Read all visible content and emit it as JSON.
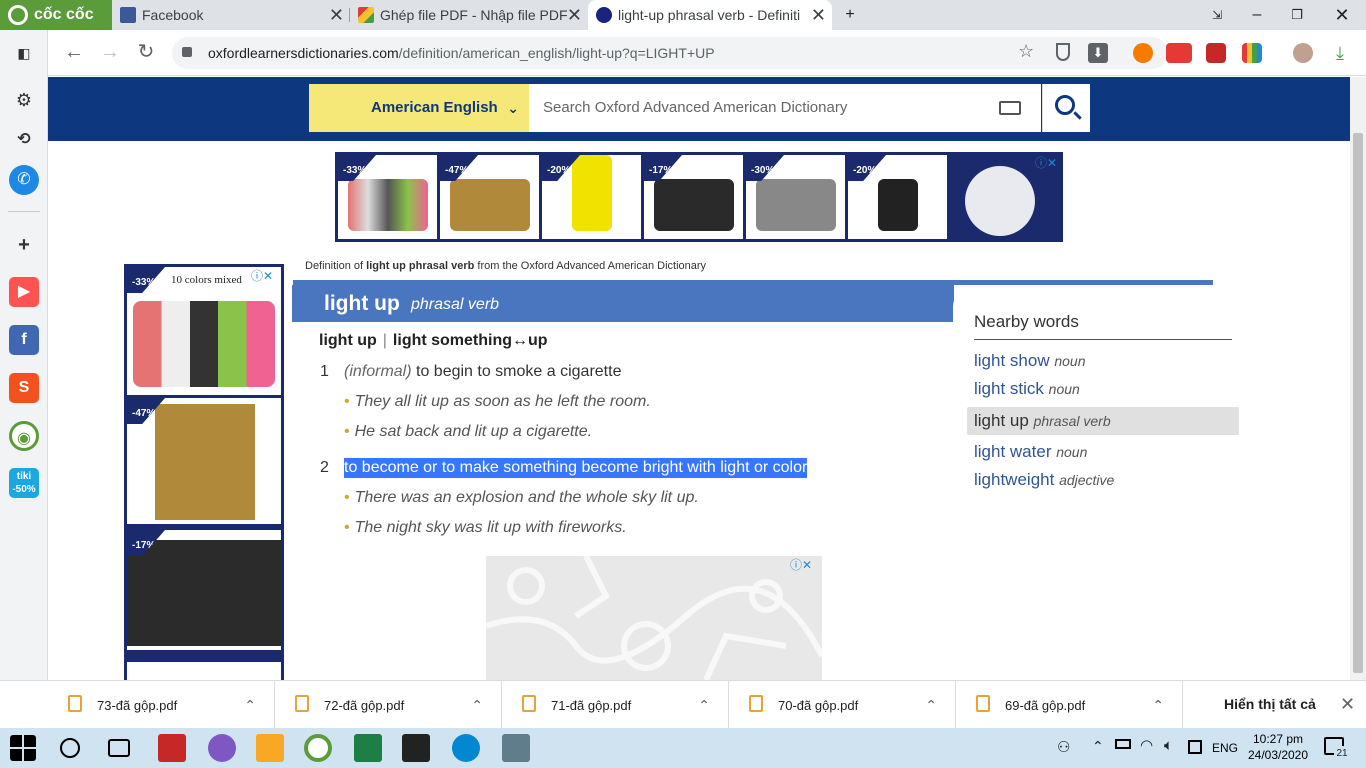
{
  "browser": {
    "brand": "cốc cốc",
    "tabs": [
      {
        "title": "Facebook",
        "favicon": "facebook-icon"
      },
      {
        "title": "Ghép file PDF - Nhập file PDF",
        "favicon": "pdf-tool-icon"
      },
      {
        "title": "light-up phrasal verb - Definiti",
        "favicon": "oxford-icon"
      }
    ],
    "url_domain": "oxfordlearnersdictionaries.com",
    "url_path": "/definition/american_english/light-up?q=LIGHT+UP"
  },
  "header": {
    "language": "American English",
    "search_placeholder": "Search Oxford Advanced American Dictionary"
  },
  "ads": {
    "top_discounts": [
      "-33%",
      "-47%",
      "-20%",
      "-17%",
      "-30%",
      "-20%"
    ],
    "side_discounts": [
      "-33%",
      "-47%",
      "-17%"
    ],
    "side_caption": "10 colors mixed"
  },
  "entry": {
    "breadcrumb_prefix": "Definition of ",
    "breadcrumb_bold": "light up phrasal verb",
    "breadcrumb_suffix": " from the Oxford Advanced American Dictionary",
    "headword": "light up",
    "pos": "phrasal verb",
    "phrasal_forms": [
      "light up",
      "light something↔up"
    ],
    "senses": [
      {
        "num": "1",
        "label": "(informal)",
        "definition": " to begin to smoke a cigarette",
        "examples": [
          "They all lit up as soon as he left the room.",
          "He sat back and lit up a cigarette."
        ]
      },
      {
        "num": "2",
        "label": "",
        "definition": "to become or to make something become bright with light or color",
        "examples": [
          "There was an explosion and the whole sky lit up.",
          "The night sky was lit up with fireworks."
        ]
      }
    ]
  },
  "nearby": {
    "title": "Nearby words",
    "words": [
      {
        "word": "light show",
        "pos": "noun"
      },
      {
        "word": "light stick",
        "pos": "noun"
      },
      {
        "word": "light up",
        "pos": "phrasal verb"
      },
      {
        "word": "light water",
        "pos": "noun"
      },
      {
        "word": "lightweight",
        "pos": "adjective"
      }
    ]
  },
  "downloads": {
    "files": [
      "73-đã gộp.pdf",
      "72-đã gộp.pdf",
      "71-đã gộp.pdf",
      "70-đã gộp.pdf",
      "69-đã gộp.pdf"
    ],
    "show_all": "Hiển thị tất cả"
  },
  "taskbar": {
    "lang": "ENG",
    "time": "10:27 pm",
    "date": "24/03/2020",
    "notifications": "21"
  },
  "colors": {
    "oxford_blue": "#0d3880",
    "header_band": "#4a76c0",
    "language_yellow": "#f5e778",
    "selection": "#3777ff"
  }
}
